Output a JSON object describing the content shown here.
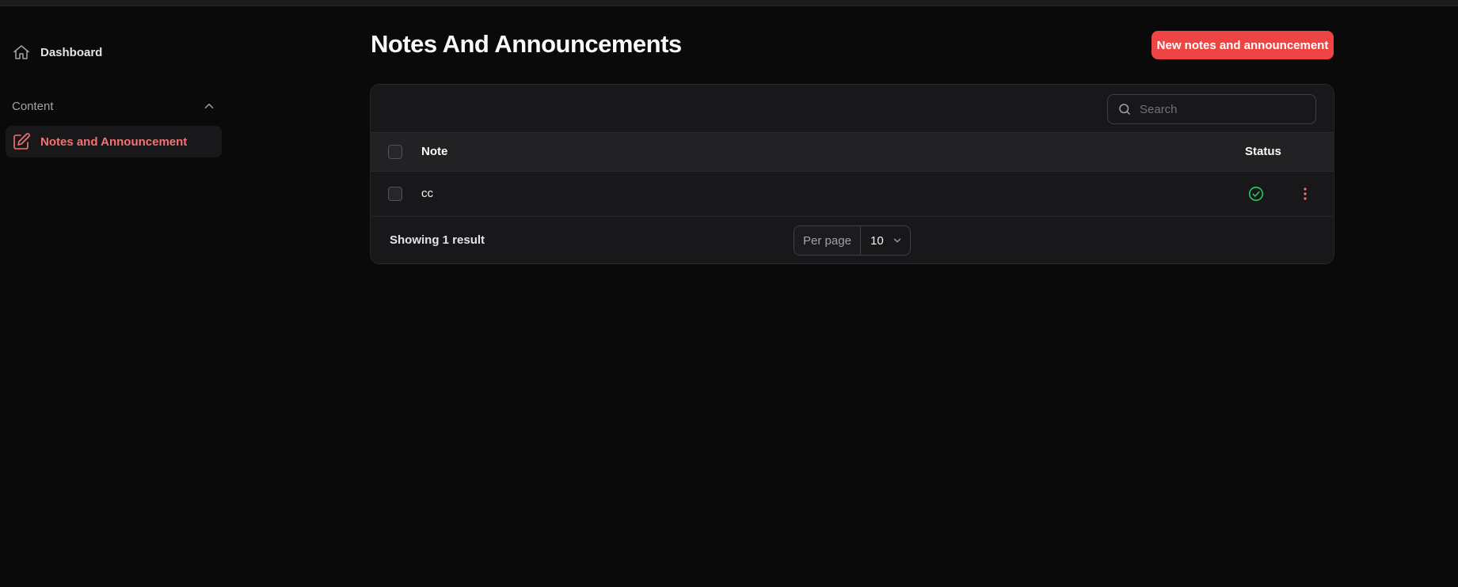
{
  "sidebar": {
    "dashboard": {
      "label": "Dashboard",
      "icon": "home-icon"
    },
    "group": {
      "label": "Content",
      "icon": "chevron-up-icon",
      "expanded": true
    },
    "items": [
      {
        "label": "Notes and Announcement",
        "icon": "pencil-square-icon",
        "active": true
      }
    ]
  },
  "header": {
    "title": "Notes And Announcements",
    "new_button_label": "New notes and announcement"
  },
  "table": {
    "search": {
      "placeholder": "Search",
      "value": ""
    },
    "columns": [
      "Note",
      "Status"
    ],
    "rows": [
      {
        "note": "cc",
        "status": "active",
        "status_icon": "check-circle-icon"
      }
    ],
    "footer": {
      "showing": "Showing 1 result",
      "per_page_label": "Per page",
      "per_page_value": "10"
    }
  },
  "colors": {
    "accent": "#ef4444",
    "accent_text": "#f87171",
    "success": "#22c55e",
    "background": "#0a0a0b",
    "panel": "#18181b"
  }
}
